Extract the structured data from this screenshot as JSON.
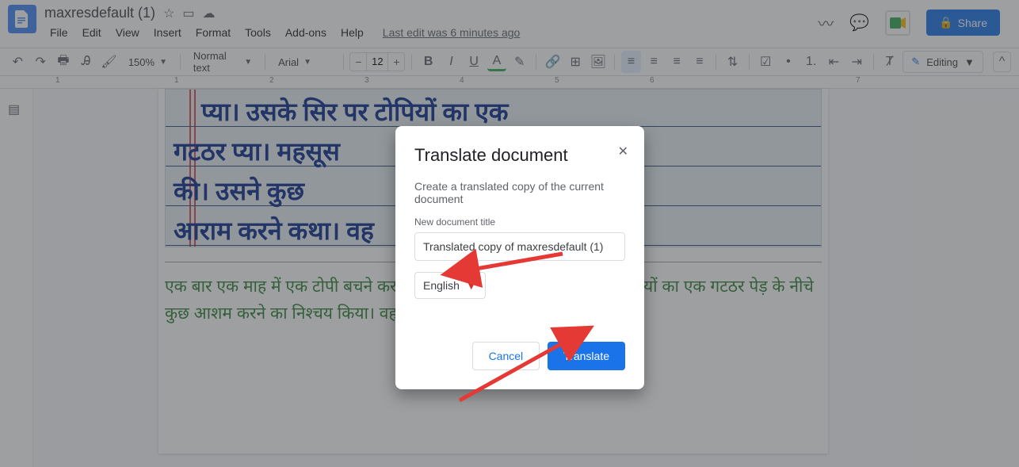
{
  "header": {
    "doc_title": "maxresdefault (1)",
    "last_edit": "Last edit was 6 minutes ago",
    "share_label": "Share"
  },
  "menubar": [
    "File",
    "Edit",
    "View",
    "Insert",
    "Format",
    "Tools",
    "Add-ons",
    "Help"
  ],
  "toolbar": {
    "zoom": "150%",
    "style": "Normal text",
    "font": "Arial",
    "font_size": "12",
    "edit_mode": "Editing"
  },
  "ruler": [
    "1",
    "1",
    "2",
    "3",
    "4",
    "5",
    "6",
    "7"
  ],
  "document_text": {
    "handwriting_lines": [
      "प्या।  उसके   सिर  पर   टोपियों   का   एक",
      "गटठर   प्या।                                  महसूस",
      "की।  उसने                                 कुछ",
      "आराम   करने                               कथा।  वह"
    ],
    "typed_hindi": "एक बार एक माह में एक टोपी बचने कर एक गाँव जा रहा प्या। उसके सिर पर टोपियों का एक गटठर  पेड़ के नीचे कुछ आशम करने का निश्चय किया। वह|"
  },
  "modal": {
    "title": "Translate document",
    "subtitle": "Create a translated copy of the current document",
    "field_label": "New document title",
    "field_value": "Translated copy of maxresdefault (1)",
    "language": "English",
    "cancel": "Cancel",
    "translate": "Translate"
  }
}
